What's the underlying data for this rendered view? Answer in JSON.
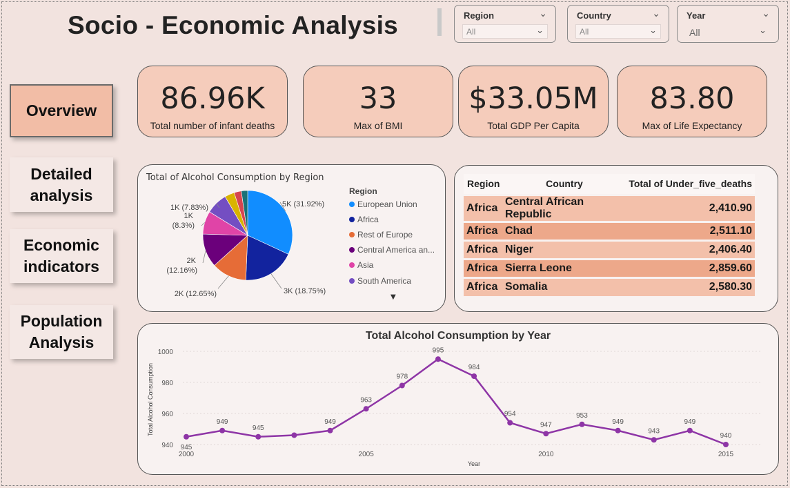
{
  "title": "Socio - Economic Analysis",
  "filters": [
    {
      "label": "Region",
      "value": "All"
    },
    {
      "label": "Country",
      "value": "All"
    },
    {
      "label": "Year",
      "value": "All"
    }
  ],
  "nav": [
    {
      "label": "Overview",
      "active": true
    },
    {
      "label": "Detailed analysis",
      "active": false
    },
    {
      "label": "Economic indicators",
      "active": false
    },
    {
      "label": "Population Analysis",
      "active": false
    }
  ],
  "kpis": [
    {
      "value": "86.96K",
      "caption": "Total number of infant deaths"
    },
    {
      "value": "33",
      "caption": "Max of BMI"
    },
    {
      "value": "$33.05M",
      "caption": "Total GDP Per Capita"
    },
    {
      "value": "83.80",
      "caption": "Max of Life Expectancy"
    }
  ],
  "pie_panel": {
    "title": "Total of Alcohol Consumption by Region",
    "legend_title": "Region",
    "legend": [
      {
        "name": "European Union",
        "color": "#118dff"
      },
      {
        "name": "Africa",
        "color": "#12239e"
      },
      {
        "name": "Rest of Europe",
        "color": "#e66c37"
      },
      {
        "name": "Central America an...",
        "color": "#6b007b"
      },
      {
        "name": "Asia",
        "color": "#e044a7"
      },
      {
        "name": "South America",
        "color": "#744ec2"
      }
    ]
  },
  "table": {
    "headers": [
      "Region",
      "Country",
      "Total of Under_five_deaths"
    ],
    "rows": [
      [
        "Africa",
        "Central African Republic",
        "2,410.90"
      ],
      [
        "Africa",
        "Chad",
        "2,511.10"
      ],
      [
        "Africa",
        "Niger",
        "2,406.40"
      ],
      [
        "Africa",
        "Sierra Leone",
        "2,859.60"
      ],
      [
        "Africa",
        "Somalia",
        "2,580.30"
      ]
    ]
  },
  "chart_data": [
    {
      "type": "pie",
      "title": "Total of Alcohol Consumption by Region",
      "legend_title": "Region",
      "legend_position": "right",
      "slices": [
        {
          "name": "European Union",
          "percent": 31.92,
          "label": "5K (31.92%)",
          "color": "#118dff"
        },
        {
          "name": "Africa",
          "percent": 18.75,
          "label": "3K (18.75%)",
          "color": "#12239e"
        },
        {
          "name": "Rest of Europe",
          "percent": 12.65,
          "label": "2K (12.65%)",
          "color": "#e66c37"
        },
        {
          "name": "Central America an...",
          "percent": 12.16,
          "label": "2K (12.16%)",
          "color": "#6b007b"
        },
        {
          "name": "Asia",
          "percent": 8.3,
          "label": "1K (8.3%)",
          "color": "#e044a7"
        },
        {
          "name": "South America",
          "percent": 7.83,
          "label": "1K (7.83%)",
          "color": "#744ec2"
        },
        {
          "percent": 3.5,
          "label": "",
          "color": "#d9b300"
        },
        {
          "percent": 2.6,
          "label": "",
          "color": "#d64550"
        },
        {
          "percent": 2.29,
          "label": "",
          "color": "#197278"
        }
      ]
    },
    {
      "type": "line",
      "title": "Total Alcohol Consumption by Year",
      "xlabel": "Year",
      "ylabel": "Total Alcohol Consumption",
      "x": [
        2000,
        2001,
        2002,
        2003,
        2004,
        2005,
        2006,
        2007,
        2008,
        2009,
        2010,
        2011,
        2012,
        2013,
        2014,
        2015
      ],
      "y": [
        945,
        949,
        945,
        946,
        949,
        963,
        978,
        995,
        984,
        954,
        947,
        953,
        949,
        943,
        949,
        940
      ],
      "point_labels": [
        "945",
        "949",
        "945",
        "",
        "949",
        "963",
        "978",
        "995",
        "984",
        "954",
        "947",
        "953",
        "949",
        "943",
        "949",
        "940"
      ],
      "xticks": [
        2000,
        2005,
        2010,
        2015
      ],
      "yticks": [
        940,
        960,
        980,
        1000
      ],
      "ylim": [
        940,
        1000
      ],
      "color": "#8e35a6",
      "grid": true
    }
  ]
}
